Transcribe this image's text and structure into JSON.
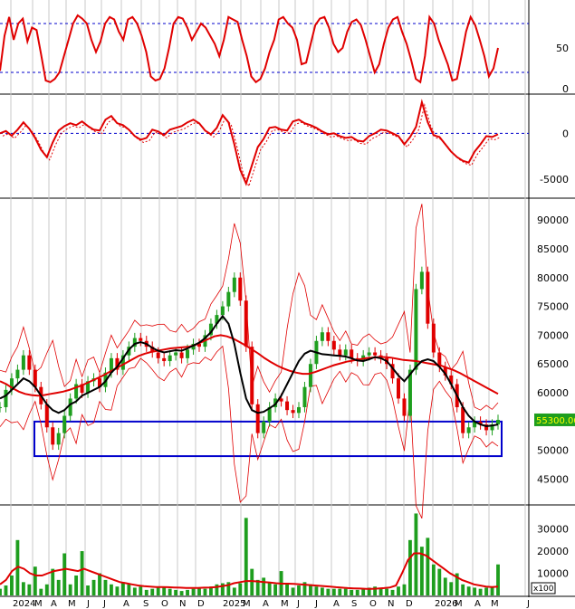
{
  "colors": {
    "price_up": "#1e9e1e",
    "price_down": "#e00000",
    "ma_short": "#000000",
    "ma_long": "#e00000",
    "bollinger": "#e00000",
    "volume": "#1e9e1e",
    "volume_ma": "#e00000",
    "oscillator": "#e00000",
    "reference_lines": "#0000cc",
    "highlight_box": "#0000cc",
    "last_price_bg": "#1e9e1e",
    "last_price_text": "#ffff00"
  },
  "chart_data": [
    {
      "type": "line",
      "panel": "oscillator",
      "y_ticks": [
        "50",
        "0"
      ],
      "ylim": [
        0,
        100
      ],
      "reference_lines": [
        80,
        20
      ],
      "series": [
        {
          "values": [
            22,
            65,
            88,
            60,
            80,
            86,
            58,
            75,
            72,
            42,
            10,
            8,
            12,
            20,
            40,
            60,
            80,
            90,
            86,
            80,
            60,
            45,
            58,
            80,
            88,
            85,
            70,
            60,
            85,
            88,
            80,
            65,
            45,
            15,
            10,
            12,
            25,
            50,
            80,
            88,
            86,
            75,
            60,
            70,
            80,
            75,
            65,
            55,
            40,
            60,
            88,
            85,
            82,
            60,
            40,
            15,
            8,
            12,
            25,
            45,
            60,
            85,
            88,
            80,
            75,
            60,
            30,
            32,
            55,
            78,
            86,
            88,
            75,
            55,
            45,
            50,
            70,
            82,
            85,
            78,
            60,
            40,
            20,
            30,
            55,
            75,
            85,
            88,
            70,
            55,
            35,
            12,
            8,
            40,
            88,
            80,
            60,
            45,
            30,
            10,
            12,
            40,
            70,
            88,
            78,
            60,
            40,
            15,
            25,
            50
          ]
        }
      ]
    },
    {
      "type": "line",
      "panel": "momentum",
      "y_ticks": [
        "0",
        "-5000"
      ],
      "ylim": [
        -6500,
        3500
      ],
      "reference_lines": [
        0
      ],
      "series": [
        {
          "values": [
            0,
            250,
            -250,
            400,
            1200,
            500,
            -500,
            -1800,
            -2600,
            -1000,
            300,
            800,
            1100,
            900,
            1300,
            800,
            400,
            300,
            1500,
            1900,
            1100,
            900,
            400,
            -300,
            -700,
            -500,
            400,
            200,
            -200,
            400,
            600,
            800,
            1200,
            1500,
            1100,
            300,
            -100,
            600,
            2000,
            1200,
            -1200,
            -4000,
            -5500,
            -3500,
            -1500,
            -600,
            600,
            700,
            400,
            300,
            1300,
            1500,
            1100,
            900,
            600,
            200,
            -100,
            0,
            -300,
            -500,
            -400,
            -800,
            -900,
            -300,
            0,
            400,
            300,
            0,
            -300,
            -1200,
            -400,
            700,
            3400,
            1200,
            -200,
            -400,
            -1200,
            -2000,
            -2600,
            -3000,
            -3200,
            -2000,
            -1200,
            -300,
            -400,
            -100
          ]
        }
      ]
    },
    {
      "type": "line",
      "panel": "price",
      "y_ticks": [
        "90000",
        "85000",
        "80000",
        "75000",
        "70000",
        "65000",
        "60000",
        "55000",
        "50000",
        "45000"
      ],
      "ylim": [
        41000,
        93000
      ],
      "last_price": "55300.00",
      "highlight_range": [
        49000,
        55000
      ],
      "series": [
        {
          "values": [
            57500,
            60500,
            62500,
            64000,
            66500,
            64000,
            61000,
            58000,
            54000,
            51000,
            53000,
            56000,
            59000,
            61500,
            60000,
            62000,
            62500,
            61000,
            63500,
            66000,
            64000,
            66500,
            68000,
            69500,
            69000,
            68000,
            67000,
            66000,
            65500,
            66500,
            67000,
            66000,
            67500,
            68500,
            68000,
            70000,
            72000,
            73500,
            75000,
            77500,
            80000,
            76000,
            68000,
            58000,
            53000,
            55000,
            57500,
            59000,
            58500,
            57000,
            56500,
            57500,
            61000,
            65000,
            69000,
            70500,
            69000,
            67500,
            66500,
            67500,
            66000,
            65500,
            66500,
            67000,
            66500,
            66000,
            65000,
            62500,
            59000,
            56000,
            64000,
            78000,
            81000,
            72000,
            67000,
            64500,
            63000,
            61500,
            57500,
            53000,
            54000,
            55000,
            54500,
            53500,
            54500,
            55300
          ]
        },
        {
          "values": [
            59000,
            59500,
            60500,
            61500,
            62500,
            62000,
            61000,
            59500,
            58000,
            57000,
            56500,
            57000,
            58000,
            58500,
            59500,
            60000,
            60500,
            61000,
            62000,
            63500,
            64500,
            66000,
            67500,
            68500,
            68800,
            68500,
            67800,
            67300,
            67000,
            67200,
            67400,
            67300,
            67700,
            68200,
            68700,
            69500,
            70500,
            72000,
            73300,
            72000,
            68500,
            63500,
            59000,
            57000,
            56500,
            56700,
            57300,
            58000,
            59500,
            61500,
            63500,
            65500,
            66800,
            67300,
            67000,
            66700,
            66600,
            66500,
            66400,
            66300,
            66000,
            65600,
            65500,
            65800,
            66200,
            66000,
            65500,
            64300,
            63000,
            62000,
            63200,
            64500,
            65500,
            65800,
            65500,
            64500,
            63300,
            61500,
            59500,
            57500,
            56000,
            55000,
            54500,
            54200,
            54300,
            54500
          ]
        },
        {
          "values": [
            62000,
            61500,
            60800,
            60200,
            59800,
            59600,
            59500,
            59600,
            59800,
            60000,
            60200,
            60500,
            60900,
            61300,
            61800,
            62300,
            62800,
            63400,
            64000,
            64600,
            65200,
            65800,
            66400,
            66800,
            67100,
            67300,
            67500,
            67700,
            67800,
            67900,
            68000,
            68300,
            68800,
            69300,
            69800,
            70000,
            69800,
            69400,
            68800,
            68200,
            67500,
            66800,
            66000,
            65300,
            64700,
            64200,
            63800,
            63500,
            63300,
            63300,
            63600,
            64000,
            64400,
            64800,
            65100,
            65400,
            65600,
            65800,
            66000,
            66100,
            66200,
            66200,
            66100,
            65900,
            65700,
            65600,
            65500,
            65300,
            65100,
            64900,
            64700,
            64300,
            63900,
            63400,
            62800,
            62200,
            61600,
            61000,
            60400,
            59800
          ]
        }
      ]
    },
    {
      "type": "bar",
      "panel": "volume",
      "y_ticks": [
        "30000",
        "20000",
        "10000"
      ],
      "ylim": [
        0,
        38000
      ],
      "unit_label": "x100",
      "x_ticks": [
        "2024",
        "M",
        "A",
        "M",
        "J",
        "J",
        "A",
        "S",
        "O",
        "N",
        "D",
        "2025",
        "M",
        "A",
        "M",
        "J",
        "J",
        "A",
        "S",
        "O",
        "N",
        "D",
        "2026",
        "M",
        "A",
        "M",
        "J"
      ],
      "values": [
        3000,
        4500,
        9000,
        25000,
        6000,
        5000,
        13000,
        3000,
        5000,
        12000,
        7000,
        19000,
        5000,
        9000,
        20000,
        4500,
        7000,
        10000,
        7000,
        5000,
        4000,
        6000,
        5000,
        3500,
        4000,
        2500,
        3000,
        4000,
        3500,
        3000,
        2500,
        2000,
        2500,
        3000,
        3500,
        3000,
        4000,
        5000,
        5500,
        6000,
        3500,
        5500,
        35000,
        12000,
        7000,
        8000,
        6000,
        5000,
        11000,
        5000,
        3500,
        4500,
        6000,
        5000,
        4000,
        3500,
        3000,
        3000,
        3000,
        3000,
        2500,
        2500,
        3000,
        3500,
        4000,
        3000,
        3000,
        2500,
        4000,
        5000,
        25000,
        37000,
        22000,
        26000,
        14000,
        12000,
        8000,
        6000,
        10000,
        5000,
        4000,
        3500,
        3000,
        3500,
        4000,
        14000
      ],
      "ma": [
        5000,
        7000,
        11000,
        13000,
        12000,
        10000,
        9000,
        9000,
        10000,
        11000,
        11500,
        12000,
        11500,
        11000,
        12000,
        11000,
        10000,
        9000,
        8000,
        7000,
        6000,
        5500,
        5000,
        4500,
        4200,
        4000,
        3800,
        3800,
        3700,
        3600,
        3500,
        3400,
        3400,
        3400,
        3500,
        3600,
        3800,
        4200,
        4600,
        5500,
        6000,
        6500,
        6500,
        6300,
        6000,
        5800,
        5500,
        5300,
        5300,
        5200,
        5000,
        4800,
        4600,
        4400,
        4200,
        4000,
        3700,
        3500,
        3300,
        3200,
        3100,
        3000,
        3000,
        3100,
        3300,
        3600,
        4500,
        10000,
        16000,
        19000,
        19000,
        18000,
        16000,
        14000,
        12000,
        10000,
        8500,
        7000,
        6000,
        5000,
        4500,
        4000,
        3800,
        4000
      ]
    }
  ]
}
